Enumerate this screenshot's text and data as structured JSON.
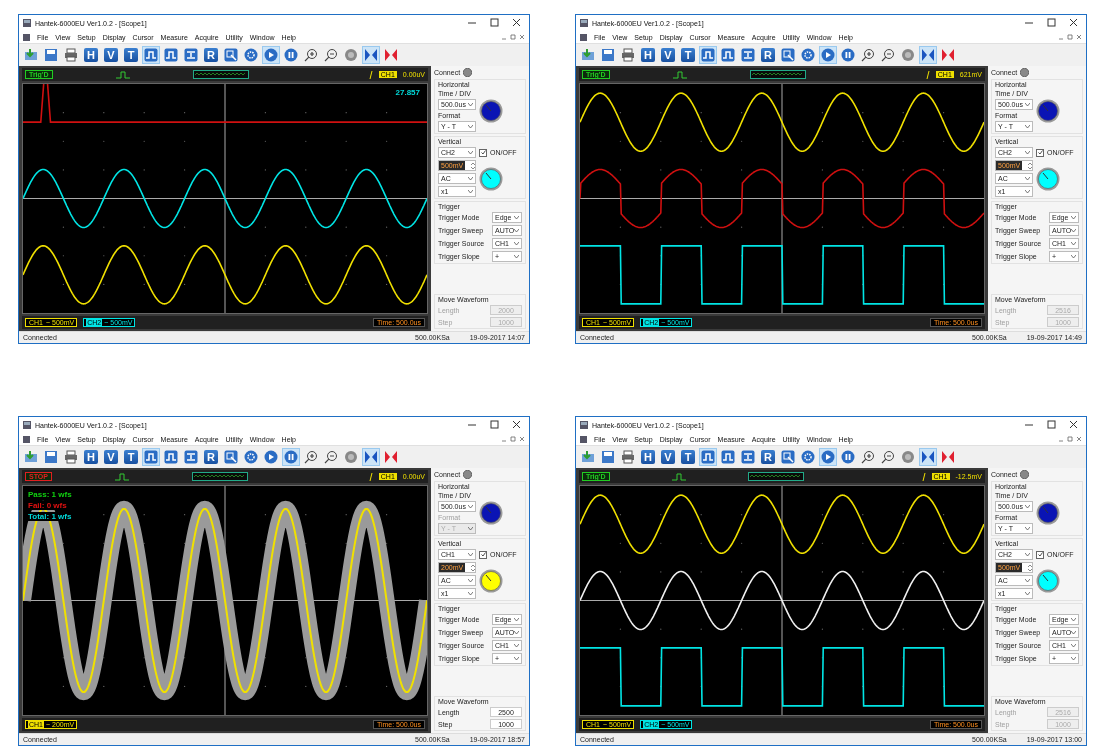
{
  "windows": [
    {
      "title": "Hantek-6000EU Ver1.0.2 - [Scope1]",
      "menu": [
        "File",
        "View",
        "Setup",
        "Display",
        "Cursor",
        "Measure",
        "Acquire",
        "Utility",
        "Window",
        "Help"
      ],
      "toolbar": [
        {
          "kind": "open",
          "pressed": false
        },
        {
          "kind": "save",
          "pressed": false
        },
        {
          "kind": "print",
          "pressed": false
        },
        {
          "kind": "letter",
          "label": "H",
          "pressed": false
        },
        {
          "kind": "letter",
          "label": "V",
          "pressed": false
        },
        {
          "kind": "letter",
          "label": "T",
          "pressed": false
        },
        {
          "kind": "pulse",
          "pressed": true
        },
        {
          "kind": "pulse",
          "pressed": false
        },
        {
          "kind": "arrows",
          "pressed": false
        },
        {
          "kind": "letter",
          "label": "R",
          "pressed": false
        },
        {
          "kind": "cursor",
          "pressed": false
        },
        {
          "kind": "gear",
          "pressed": false
        },
        {
          "kind": "play",
          "pressed": true
        },
        {
          "kind": "pause",
          "pressed": false
        },
        {
          "kind": "zoom-in",
          "pressed": false
        },
        {
          "kind": "zoom-out",
          "pressed": false
        },
        {
          "kind": "disc",
          "pressed": false
        },
        {
          "kind": "bowtie-blue",
          "pressed": true
        },
        {
          "kind": "bowtie-red",
          "pressed": false
        }
      ],
      "trigger_status": {
        "text": "Trig'D",
        "color": "#22cc22"
      },
      "trigger_channel": "CH1",
      "trigger_level": "0.00uV",
      "readouts": [
        {
          "kind": "measure",
          "text": "27.857",
          "color": "#00d8d8"
        }
      ],
      "traces": [
        {
          "kind": "spike",
          "color": "#d01010"
        },
        {
          "kind": "sine",
          "color": "#00e5e5"
        },
        {
          "kind": "sine",
          "color": "#f0e000"
        }
      ],
      "channel_tags": [
        {
          "channel": "CH1",
          "scale": "~ 500mV",
          "color": "#f0e000",
          "selected": false
        },
        {
          "channel": "CH2",
          "scale": "~ 500mV",
          "color": "#00e5e5",
          "selected": true
        }
      ],
      "time_base": "Time: 500.0us",
      "panel": {
        "connect": "Connect",
        "horizontal": {
          "title": "Horizontal",
          "time_label": "Time / DIV",
          "time_value": "500.0us",
          "format_label": "Format",
          "format_value": "Y - T",
          "format_disabled": false
        },
        "vertical": {
          "title": "Vertical",
          "channel": "CH2",
          "onoff_label": "ON/OFF",
          "onoff_checked": true,
          "volts": "500mV",
          "coupling": "AC",
          "probe": "x1",
          "color": "#00ffff"
        },
        "trigger": {
          "title": "Trigger",
          "rows": [
            {
              "label": "Trigger Mode",
              "value": "Edge"
            },
            {
              "label": "Trigger Sweep",
              "value": "AUTO"
            },
            {
              "label": "Trigger Source",
              "value": "CH1"
            },
            {
              "label": "Trigger Slope",
              "value": "+"
            }
          ]
        },
        "move": {
          "title": "Move Waveform",
          "length_label": "Length",
          "length": "2000",
          "length_disabled": true,
          "step_label": "Step",
          "step": "1000",
          "step_disabled": true
        }
      },
      "status": {
        "text": "Connected",
        "rate": "500.00KSa",
        "date": "19-09-2017  14:07"
      }
    },
    {
      "title": "Hantek-6000EU Ver1.0.2 - [Scope1]",
      "menu": [
        "File",
        "View",
        "Setup",
        "Display",
        "Cursor",
        "Measure",
        "Acquire",
        "Utility",
        "Window",
        "Help"
      ],
      "toolbar": [
        {
          "kind": "open",
          "pressed": false
        },
        {
          "kind": "save",
          "pressed": false
        },
        {
          "kind": "print",
          "pressed": false
        },
        {
          "kind": "letter",
          "label": "H",
          "pressed": false
        },
        {
          "kind": "letter",
          "label": "V",
          "pressed": false
        },
        {
          "kind": "letter",
          "label": "T",
          "pressed": false
        },
        {
          "kind": "pulse",
          "pressed": true
        },
        {
          "kind": "pulse",
          "pressed": false
        },
        {
          "kind": "arrows",
          "pressed": false
        },
        {
          "kind": "letter",
          "label": "R",
          "pressed": false
        },
        {
          "kind": "cursor",
          "pressed": false
        },
        {
          "kind": "gear",
          "pressed": false
        },
        {
          "kind": "play",
          "pressed": true
        },
        {
          "kind": "pause",
          "pressed": false
        },
        {
          "kind": "zoom-in",
          "pressed": false
        },
        {
          "kind": "zoom-out",
          "pressed": false
        },
        {
          "kind": "disc",
          "pressed": false
        },
        {
          "kind": "bowtie-blue",
          "pressed": true
        },
        {
          "kind": "bowtie-red",
          "pressed": false
        }
      ],
      "trigger_status": {
        "text": "Trig'D",
        "color": "#22cc22"
      },
      "trigger_channel": "CH1",
      "trigger_level": "621mV",
      "traces": [
        {
          "kind": "sine",
          "color": "#f0e000"
        },
        {
          "kind": "clipped",
          "color": "#d01010"
        },
        {
          "kind": "square",
          "color": "#00e5e5"
        }
      ],
      "channel_tags": [
        {
          "channel": "CH1",
          "scale": "~ 500mV",
          "color": "#f0e000",
          "selected": false
        },
        {
          "channel": "CH2",
          "scale": "~ 500mV",
          "color": "#00e5e5",
          "selected": true
        }
      ],
      "time_base": "Time: 500.0us",
      "panel": {
        "connect": "Connect",
        "horizontal": {
          "title": "Horizontal",
          "time_label": "Time / DIV",
          "time_value": "500.0us",
          "format_label": "Format",
          "format_value": "Y - T",
          "format_disabled": false
        },
        "vertical": {
          "title": "Vertical",
          "channel": "CH2",
          "onoff_label": "ON/OFF",
          "onoff_checked": true,
          "volts": "500mV",
          "coupling": "AC",
          "probe": "x1",
          "color": "#00ffff"
        },
        "trigger": {
          "title": "Trigger",
          "rows": [
            {
              "label": "Trigger Mode",
              "value": "Edge"
            },
            {
              "label": "Trigger Sweep",
              "value": "AUTO"
            },
            {
              "label": "Trigger Source",
              "value": "CH1"
            },
            {
              "label": "Trigger Slope",
              "value": "+"
            }
          ]
        },
        "move": {
          "title": "Move Waveform",
          "length_label": "Length",
          "length": "2516",
          "length_disabled": true,
          "step_label": "Step",
          "step": "1000",
          "step_disabled": true
        }
      },
      "status": {
        "text": "Connected",
        "rate": "500.00KSa",
        "date": "19-09-2017  14:49"
      }
    },
    {
      "title": "Hantek-6000EU Ver1.0.2 - [Scope1]",
      "menu": [
        "File",
        "View",
        "Setup",
        "Display",
        "Cursor",
        "Measure",
        "Acquire",
        "Utility",
        "Window",
        "Help"
      ],
      "toolbar": [
        {
          "kind": "open",
          "pressed": false
        },
        {
          "kind": "save",
          "pressed": false
        },
        {
          "kind": "print",
          "pressed": false
        },
        {
          "kind": "letter",
          "label": "H",
          "pressed": false
        },
        {
          "kind": "letter",
          "label": "V",
          "pressed": false
        },
        {
          "kind": "letter",
          "label": "T",
          "pressed": false
        },
        {
          "kind": "pulse",
          "pressed": true
        },
        {
          "kind": "pulse",
          "pressed": false
        },
        {
          "kind": "arrows",
          "pressed": false
        },
        {
          "kind": "letter",
          "label": "R",
          "pressed": false
        },
        {
          "kind": "cursor",
          "pressed": false
        },
        {
          "kind": "gear",
          "pressed": false
        },
        {
          "kind": "play",
          "pressed": false
        },
        {
          "kind": "pause",
          "pressed": true
        },
        {
          "kind": "zoom-in",
          "pressed": false
        },
        {
          "kind": "zoom-out",
          "pressed": false
        },
        {
          "kind": "disc",
          "pressed": false
        },
        {
          "kind": "bowtie-blue",
          "pressed": true
        },
        {
          "kind": "bowtie-red",
          "pressed": false
        }
      ],
      "trigger_status": {
        "text": "STOP",
        "color": "#e02020"
      },
      "trigger_channel": "CH1",
      "trigger_level": "0.00uV",
      "readouts": [
        {
          "kind": "counter",
          "text": "Pass: 1 wfs",
          "color": "#10d010"
        },
        {
          "kind": "counter",
          "text": "Fail: 0 wfs",
          "color": "#e01010"
        },
        {
          "kind": "counter",
          "text": "Total: 1 wfs",
          "color": "#00d8d8"
        }
      ],
      "traces": [
        {
          "kind": "band",
          "color": "#f0e000"
        }
      ],
      "channel_tags": [
        {
          "channel": "CH1",
          "scale": "~ 200mV",
          "color": "#f0e000",
          "selected": true
        }
      ],
      "time_base": "Time: 500.0us",
      "panel": {
        "connect": "Connect",
        "horizontal": {
          "title": "Horizontal",
          "time_label": "Time / DIV",
          "time_value": "500.0us",
          "format_label": "Format",
          "format_value": "Y - T",
          "format_disabled": true
        },
        "vertical": {
          "title": "Vertical",
          "channel": "CH1",
          "onoff_label": "ON/OFF",
          "onoff_checked": true,
          "volts": "200mV",
          "coupling": "AC",
          "probe": "x1",
          "color": "#ffff00"
        },
        "trigger": {
          "title": "Trigger",
          "rows": [
            {
              "label": "Trigger Mode",
              "value": "Edge"
            },
            {
              "label": "Trigger Sweep",
              "value": "AUTO"
            },
            {
              "label": "Trigger Source",
              "value": "CH1"
            },
            {
              "label": "Trigger Slope",
              "value": "+"
            }
          ]
        },
        "move": {
          "title": "Move Waveform",
          "length_label": "Length",
          "length": "2500",
          "length_disabled": false,
          "step_label": "Step",
          "step": "1000",
          "step_disabled": false
        }
      },
      "status": {
        "text": "Connected",
        "rate": "500.00KSa",
        "date": "19-09-2017  18:57"
      }
    },
    {
      "title": "Hantek-6000EU Ver1.0.2 - [Scope1]",
      "menu": [
        "File",
        "View",
        "Setup",
        "Display",
        "Cursor",
        "Measure",
        "Acquire",
        "Utility",
        "Window",
        "Help"
      ],
      "toolbar": [
        {
          "kind": "open",
          "pressed": false
        },
        {
          "kind": "save",
          "pressed": false
        },
        {
          "kind": "print",
          "pressed": false
        },
        {
          "kind": "letter",
          "label": "H",
          "pressed": false
        },
        {
          "kind": "letter",
          "label": "V",
          "pressed": false
        },
        {
          "kind": "letter",
          "label": "T",
          "pressed": false
        },
        {
          "kind": "pulse",
          "pressed": true
        },
        {
          "kind": "pulse",
          "pressed": false
        },
        {
          "kind": "arrows",
          "pressed": false
        },
        {
          "kind": "letter",
          "label": "R",
          "pressed": false
        },
        {
          "kind": "cursor",
          "pressed": false
        },
        {
          "kind": "gear",
          "pressed": false
        },
        {
          "kind": "play",
          "pressed": true
        },
        {
          "kind": "pause",
          "pressed": false
        },
        {
          "kind": "zoom-in",
          "pressed": false
        },
        {
          "kind": "zoom-out",
          "pressed": false
        },
        {
          "kind": "disc",
          "pressed": false
        },
        {
          "kind": "bowtie-blue",
          "pressed": true
        },
        {
          "kind": "bowtie-red",
          "pressed": false
        }
      ],
      "trigger_status": {
        "text": "Trig'D",
        "color": "#22cc22"
      },
      "trigger_channel": "CH1",
      "trigger_level": "-12.5mV",
      "traces": [
        {
          "kind": "sine",
          "color": "#f0e000"
        },
        {
          "kind": "sine",
          "color": "#f0f0f0"
        },
        {
          "kind": "square",
          "color": "#00e5e5"
        }
      ],
      "channel_tags": [
        {
          "channel": "CH1",
          "scale": "~ 500mV",
          "color": "#f0e000",
          "selected": false
        },
        {
          "channel": "CH2",
          "scale": "~ 500mV",
          "color": "#00e5e5",
          "selected": true
        }
      ],
      "time_base": "Time: 500.0us",
      "panel": {
        "connect": "Connect",
        "horizontal": {
          "title": "Horizontal",
          "time_label": "Time / DIV",
          "time_value": "500.0us",
          "format_label": "Format",
          "format_value": "Y - T",
          "format_disabled": false
        },
        "vertical": {
          "title": "Vertical",
          "channel": "CH2",
          "onoff_label": "ON/OFF",
          "onoff_checked": true,
          "volts": "500mV",
          "coupling": "AC",
          "probe": "x1",
          "color": "#00ffff"
        },
        "trigger": {
          "title": "Trigger",
          "rows": [
            {
              "label": "Trigger Mode",
              "value": "Edge"
            },
            {
              "label": "Trigger Sweep",
              "value": "AUTO"
            },
            {
              "label": "Trigger Source",
              "value": "CH1"
            },
            {
              "label": "Trigger Slope",
              "value": "+"
            }
          ]
        },
        "move": {
          "title": "Move Waveform",
          "length_label": "Length",
          "length": "2516",
          "length_disabled": true,
          "step_label": "Step",
          "step": "1000",
          "step_disabled": true
        }
      },
      "status": {
        "text": "Connected",
        "rate": "500.00KSa",
        "date": "19-09-2017  13:00"
      }
    }
  ]
}
